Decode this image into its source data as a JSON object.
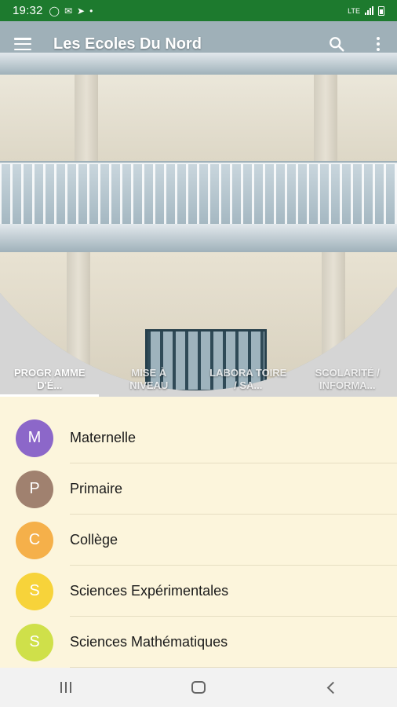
{
  "status_bar": {
    "time": "19:32",
    "left_icons": [
      "whatsapp-icon",
      "gmail-icon",
      "telegram-icon",
      "dot-icon"
    ],
    "network": "LTE",
    "bg_color": "#1d7a2e"
  },
  "toolbar": {
    "menu_icon": "menu-icon",
    "title": "Les Ecoles Du Nord",
    "search_icon": "search-icon",
    "more_icon": "more-vert-icon"
  },
  "tabs": [
    {
      "label": "PROGR AMME D'É...",
      "selected": true
    },
    {
      "label": "MISE À NIVEAU",
      "selected": false
    },
    {
      "label": "LABORA TOIRE / SA...",
      "selected": false
    },
    {
      "label": "SCOLARITÉ / INFORMA...",
      "selected": false
    }
  ],
  "list": {
    "bg_color": "#fcf5dc",
    "items": [
      {
        "initial": "M",
        "label": "Maternelle",
        "color": "#8c67c9"
      },
      {
        "initial": "P",
        "label": "Primaire",
        "color": "#a0816f"
      },
      {
        "initial": "C",
        "label": "Collège",
        "color": "#f5b04a"
      },
      {
        "initial": "S",
        "label": "Sciences Expérimentales",
        "color": "#f7d33a"
      },
      {
        "initial": "S",
        "label": "Sciences Mathématiques",
        "color": "#cfe04a"
      }
    ]
  },
  "nav_bar": {
    "buttons": [
      "recents-icon",
      "home-icon",
      "back-icon"
    ]
  }
}
